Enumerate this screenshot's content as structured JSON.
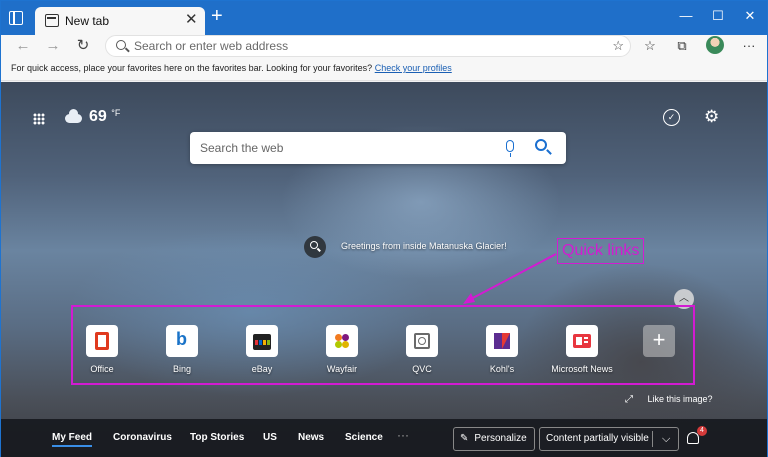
{
  "browser": {
    "tab_title": "New tab",
    "address_placeholder": "Search or enter web address"
  },
  "favorites_bar": {
    "message": "For quick access, place your favorites here on the favorites bar. Looking for your favorites?",
    "link": "Check your profiles"
  },
  "weather": {
    "temperature": "69",
    "unit": "°F",
    "icon": "cloud-icon"
  },
  "search": {
    "placeholder": "Search the web"
  },
  "greeting": "Greetings from inside Matanuska Glacier!",
  "annotation": "Quick links",
  "quick_links": [
    {
      "label": "Office",
      "icon": "office-icon",
      "color": "#e03a1e"
    },
    {
      "label": "Bing",
      "icon": "bing-icon",
      "color": "#1a73c8"
    },
    {
      "label": "eBay",
      "icon": "ebay-icon",
      "color": "#e53238"
    },
    {
      "label": "Wayfair",
      "icon": "wayfair-icon",
      "color": "#7f187f"
    },
    {
      "label": "QVC",
      "icon": "qvc-icon",
      "color": "#6a6a6a"
    },
    {
      "label": "Kohl's",
      "icon": "kohls-icon",
      "color": "#5c2d91"
    },
    {
      "label": "Microsoft News",
      "icon": "msn-icon",
      "color": "#e8363f"
    }
  ],
  "like_image": "Like this image?",
  "feed": {
    "tabs": [
      "My Feed",
      "Coronavirus",
      "Top Stories",
      "US",
      "News",
      "Science"
    ],
    "more": "···",
    "personalize": "Personalize",
    "layout_select": "Content partially visible",
    "notification_count": "4"
  }
}
